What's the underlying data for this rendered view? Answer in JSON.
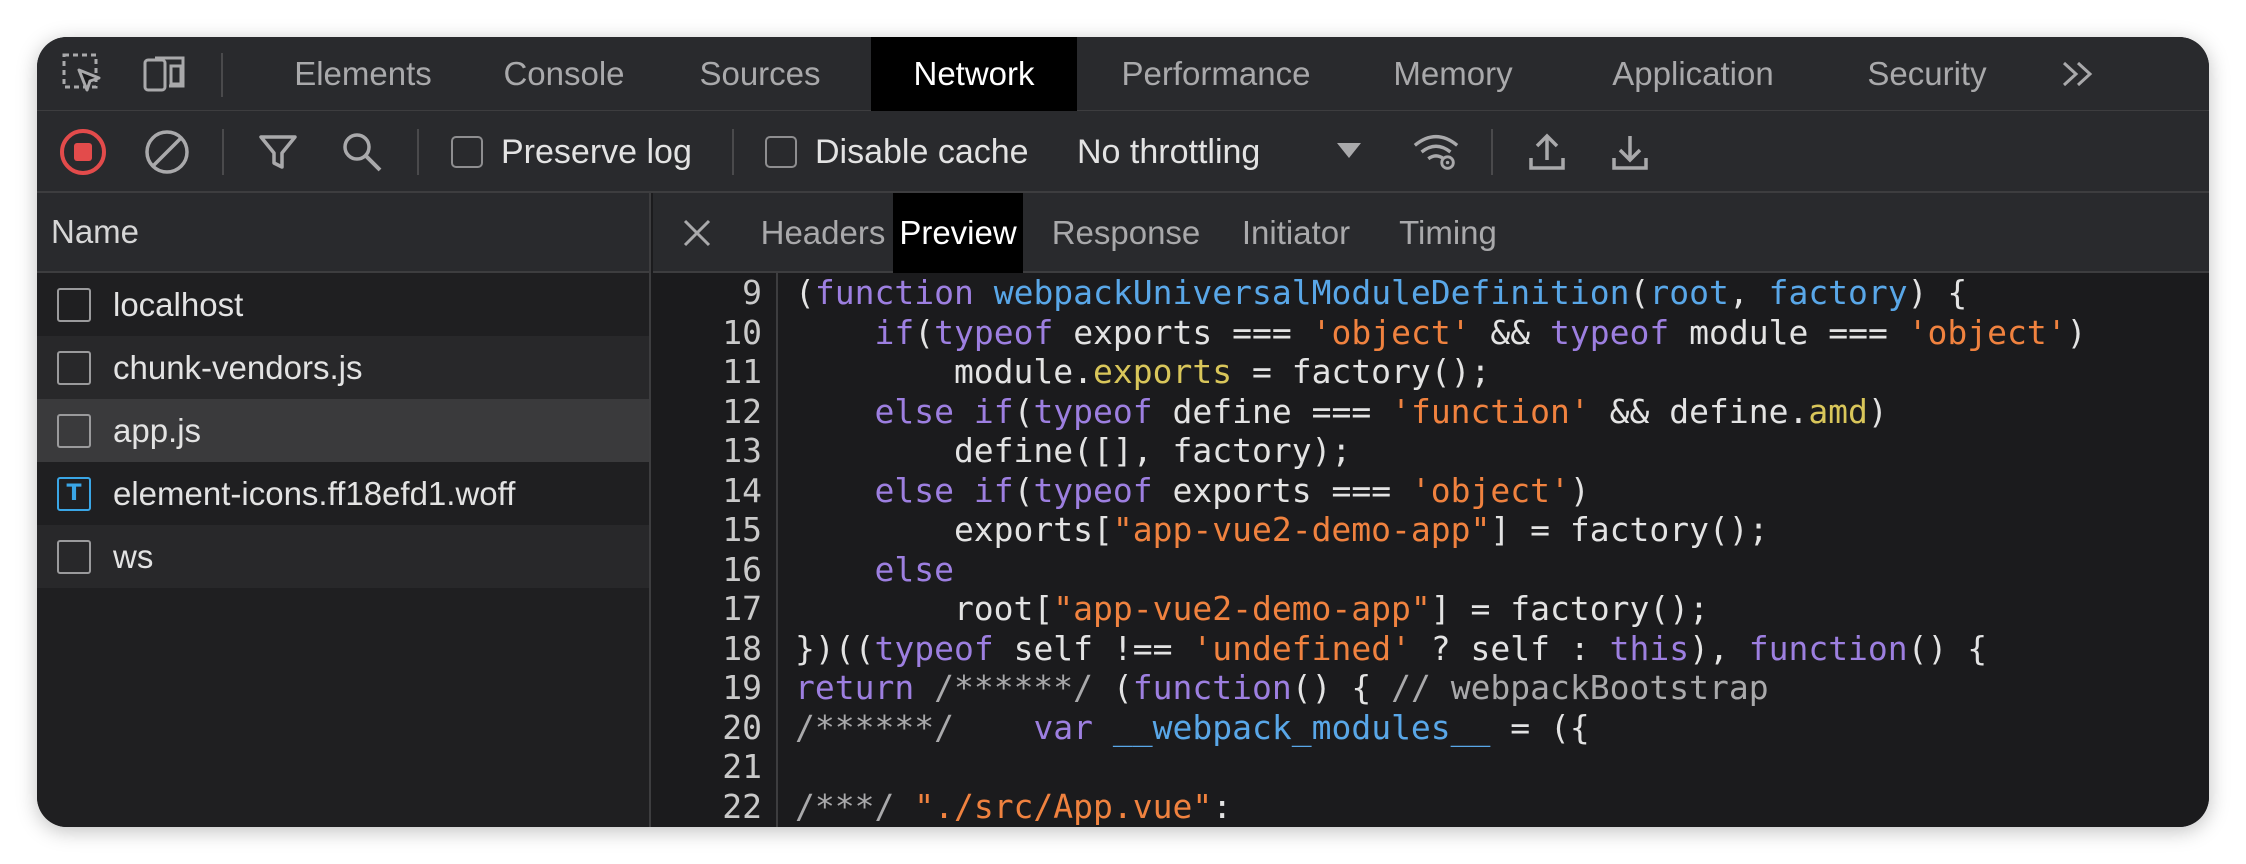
{
  "tabs": {
    "items": [
      "Elements",
      "Console",
      "Sources",
      "Network",
      "Performance",
      "Memory",
      "Application",
      "Security"
    ],
    "active": "Network",
    "more_icon": "chevron-double-right-icon"
  },
  "toolbar": {
    "preserve_log_label": "Preserve log",
    "disable_cache_label": "Disable cache",
    "throttling_value": "No throttling"
  },
  "requests": {
    "header": "Name",
    "items": [
      {
        "name": "localhost",
        "icon": "document-icon"
      },
      {
        "name": "chunk-vendors.js",
        "icon": "document-icon"
      },
      {
        "name": "app.js",
        "icon": "document-icon"
      },
      {
        "name": "element-icons.ff18efd1.woff",
        "icon": "font-file-icon"
      },
      {
        "name": "ws",
        "icon": "document-icon"
      }
    ],
    "selected": "app.js"
  },
  "preview": {
    "tabs": [
      "Headers",
      "Preview",
      "Response",
      "Initiator",
      "Timing"
    ],
    "active": "Preview",
    "font_icon_glyph": "T",
    "line_numbers": [
      "9",
      "10",
      "11",
      "12",
      "13",
      "14",
      "15",
      "16",
      "17",
      "18",
      "19",
      "20",
      "21",
      "22"
    ],
    "lines": [
      [
        [
          "p",
          "("
        ],
        [
          "kw",
          "function"
        ],
        [
          "p",
          " "
        ],
        [
          "fn",
          "webpackUniversalModuleDefinition"
        ],
        [
          "p",
          "("
        ],
        [
          "fn",
          "root"
        ],
        [
          "p",
          ", "
        ],
        [
          "fn",
          "factory"
        ],
        [
          "p",
          ") {"
        ]
      ],
      [
        [
          "p",
          "    "
        ],
        [
          "kw",
          "if"
        ],
        [
          "p",
          "("
        ],
        [
          "kw",
          "typeof"
        ],
        [
          "p",
          " exports === "
        ],
        [
          "str",
          "'object'"
        ],
        [
          "p",
          " && "
        ],
        [
          "kw",
          "typeof"
        ],
        [
          "p",
          " module === "
        ],
        [
          "str",
          "'object'"
        ],
        [
          "p",
          ")"
        ]
      ],
      [
        [
          "p",
          "        module."
        ],
        [
          "prop",
          "exports"
        ],
        [
          "p",
          " = factory();"
        ]
      ],
      [
        [
          "p",
          "    "
        ],
        [
          "kw",
          "else if"
        ],
        [
          "p",
          "("
        ],
        [
          "kw",
          "typeof"
        ],
        [
          "p",
          " define === "
        ],
        [
          "str",
          "'function'"
        ],
        [
          "p",
          " && define."
        ],
        [
          "prop",
          "amd"
        ],
        [
          "p",
          ")"
        ]
      ],
      [
        [
          "p",
          "        define([], factory);"
        ]
      ],
      [
        [
          "p",
          "    "
        ],
        [
          "kw",
          "else if"
        ],
        [
          "p",
          "("
        ],
        [
          "kw",
          "typeof"
        ],
        [
          "p",
          " exports === "
        ],
        [
          "str",
          "'object'"
        ],
        [
          "p",
          ")"
        ]
      ],
      [
        [
          "p",
          "        exports["
        ],
        [
          "str",
          "\"app-vue2-demo-app\""
        ],
        [
          "p",
          "] = factory();"
        ]
      ],
      [
        [
          "p",
          "    "
        ],
        [
          "kw",
          "else"
        ]
      ],
      [
        [
          "p",
          "        root["
        ],
        [
          "str",
          "\"app-vue2-demo-app\""
        ],
        [
          "p",
          "] = factory();"
        ]
      ],
      [
        [
          "p",
          "})(("
        ],
        [
          "kw",
          "typeof"
        ],
        [
          "p",
          " self !== "
        ],
        [
          "str",
          "'undefined'"
        ],
        [
          "p",
          " ? self : "
        ],
        [
          "kw",
          "this"
        ],
        [
          "p",
          "), "
        ],
        [
          "kw",
          "function"
        ],
        [
          "p",
          "() {"
        ]
      ],
      [
        [
          "kw",
          "return"
        ],
        [
          "p",
          " "
        ],
        [
          "cmt",
          "/******/"
        ],
        [
          "p",
          " ("
        ],
        [
          "kw",
          "function"
        ],
        [
          "p",
          "() { "
        ],
        [
          "cmt",
          "// webpackBootstrap"
        ]
      ],
      [
        [
          "cmt",
          "/******/"
        ],
        [
          "p",
          "    "
        ],
        [
          "kw",
          "var"
        ],
        [
          "p",
          " "
        ],
        [
          "fn",
          "__webpack_modules__"
        ],
        [
          "p",
          " = ({"
        ]
      ],
      [
        [
          "p",
          ""
        ]
      ],
      [
        [
          "cmt",
          "/***/"
        ],
        [
          "p",
          " "
        ],
        [
          "str",
          "\"./src/App.vue\""
        ],
        [
          "p",
          ":"
        ]
      ]
    ]
  },
  "colors": {
    "record": "#e34b4b",
    "font_icon": "#3aa6e6",
    "keyword": "#9d7fe0",
    "function": "#59a7e8",
    "string": "#f0823f",
    "property": "#d9c65a"
  }
}
